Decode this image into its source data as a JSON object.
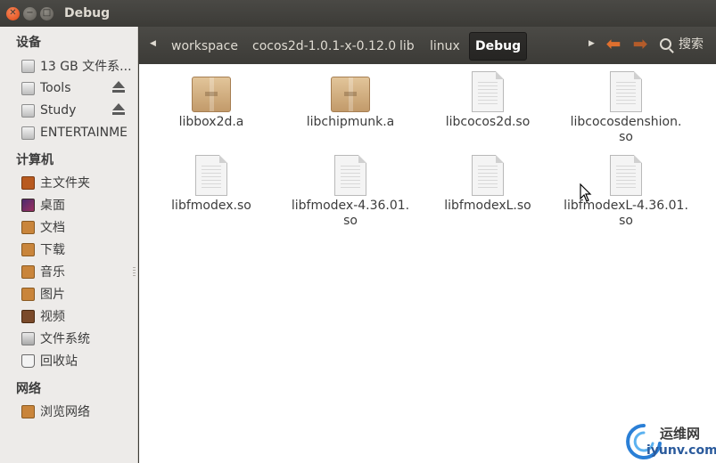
{
  "window": {
    "title": "Debug"
  },
  "sidebar": {
    "devices": {
      "heading": "设备",
      "items": [
        {
          "label": "13 GB 文件系...",
          "icon": "drive-icon",
          "eject": false
        },
        {
          "label": "Tools",
          "icon": "drive-icon",
          "eject": true
        },
        {
          "label": "Study",
          "icon": "drive-icon",
          "eject": true
        },
        {
          "label": "ENTERTAINME",
          "icon": "drive-icon",
          "eject": false
        }
      ]
    },
    "computer": {
      "heading": "计算机",
      "items": [
        {
          "label": "主文件夹",
          "icon": "home-folder-icon"
        },
        {
          "label": "桌面",
          "icon": "desktop-icon"
        },
        {
          "label": "文档",
          "icon": "documents-folder-icon"
        },
        {
          "label": "下载",
          "icon": "downloads-folder-icon"
        },
        {
          "label": "音乐",
          "icon": "music-folder-icon"
        },
        {
          "label": "图片",
          "icon": "pictures-folder-icon"
        },
        {
          "label": "视频",
          "icon": "videos-folder-icon"
        },
        {
          "label": "文件系统",
          "icon": "filesystem-icon"
        },
        {
          "label": "回收站",
          "icon": "trash-icon"
        }
      ]
    },
    "network": {
      "heading": "网络",
      "items": [
        {
          "label": "浏览网络",
          "icon": "network-icon"
        }
      ]
    }
  },
  "pathbar": {
    "crumbs": [
      "workspace",
      "cocos2d-1.0.1-x-0.12.0",
      "lib",
      "linux",
      "Debug"
    ],
    "active": "Debug"
  },
  "search": {
    "label": "搜索"
  },
  "files": [
    {
      "name": "libbox2d.a",
      "type": "archive"
    },
    {
      "name": "libchipmunk.a",
      "type": "archive"
    },
    {
      "name": "libcocos2d.so",
      "type": "shared-library"
    },
    {
      "name_line1": "libcocosdenshion.",
      "name_line2": "so",
      "type": "shared-library"
    },
    {
      "name": "libfmodex.so",
      "type": "shared-library"
    },
    {
      "name_line1": "libfmodex-4.36.01.",
      "name_line2": "so",
      "type": "shared-library"
    },
    {
      "name": "libfmodexL.so",
      "type": "shared-library"
    },
    {
      "name_line1": "libfmodexL-4.36.01.",
      "name_line2": "so",
      "type": "shared-library"
    }
  ],
  "watermark": {
    "brand": "运维网",
    "url": "iyunv.com"
  },
  "colors": {
    "accent": "#dd4814",
    "titlebar": "#3c3b37",
    "sidebar": "#edebe9"
  }
}
